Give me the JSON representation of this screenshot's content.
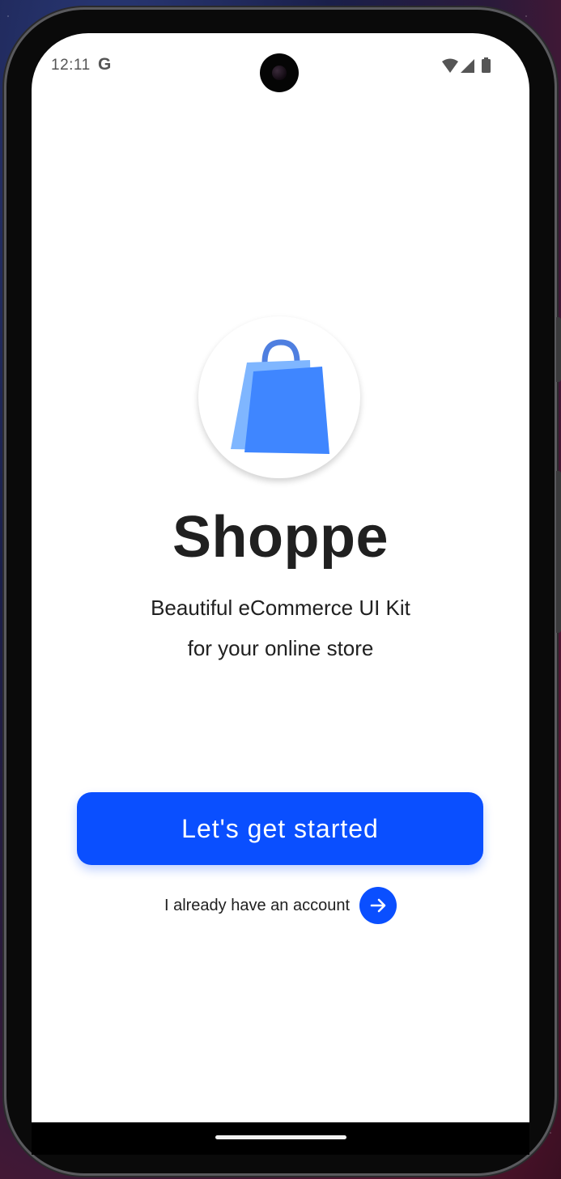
{
  "status_bar": {
    "time": "12:11",
    "google_indicator": "G",
    "icons": [
      "wifi-icon",
      "signal-icon",
      "battery-icon"
    ]
  },
  "welcome": {
    "logo_icon": "shopping-bag-icon",
    "app_name": "Shoppe",
    "tagline_line1": "Beautiful eCommerce UI Kit",
    "tagline_line2": "for your online store"
  },
  "actions": {
    "primary_label": "Let's get started",
    "secondary_label": "I already have an account",
    "secondary_icon": "arrow-right-icon"
  },
  "colors": {
    "accent": "#0a4fff",
    "bag_light": "#7fb6ff",
    "bag_dark": "#3f86ff",
    "handle": "#4f7fe0",
    "text": "#202020"
  }
}
